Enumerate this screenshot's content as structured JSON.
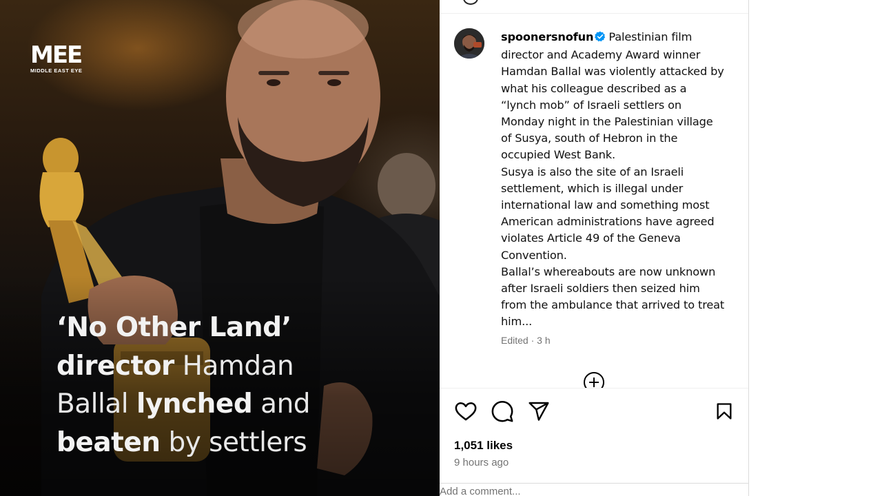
{
  "image": {
    "logo_mark": "MEE",
    "logo_sub": "MIDDLE EAST EYE",
    "headline": {
      "part1": "‘No Other Land’",
      "part2": "director",
      "part3": " Hamdan",
      "part4": "Ballal ",
      "part5": "lynched",
      "part6": " and",
      "part7": "beaten",
      "part8": " by settlers"
    }
  },
  "post": {
    "username": "spoonersnofun",
    "verified": true,
    "caption_first": "Palestinian film director and Academy Award winner Hamdan Ballal was violently attacked by what his colleague described as a “lynch mob” of Israeli settlers on Monday night in the Palestinian village of Susya, south of Hebron in the occupied West Bank.",
    "caption_second": "Susya is also the site of an Israeli settlement, which is illegal under international law and something most American administrations have agreed violates Article 49 of the Geneva Convention.",
    "caption_third": "Ballal’s whereabouts are now unknown after Israeli soldiers then seized him from the ambulance that arrived to treat him...",
    "meta": "Edited · 3 h",
    "likes": "1,051 likes",
    "time_ago": "9 hours ago",
    "comment_placeholder": "Add a comment..."
  },
  "icons": {
    "like": "heart-icon",
    "comment": "comment-bubble-icon",
    "share": "paper-plane-icon",
    "save": "bookmark-icon",
    "verified": "verified-badge-icon",
    "add_comment": "circle-plus-icon"
  },
  "colors": {
    "verified_blue": "#0095f6",
    "text_primary": "#000000",
    "text_secondary": "#737373",
    "divider": "#dbdbdb"
  }
}
